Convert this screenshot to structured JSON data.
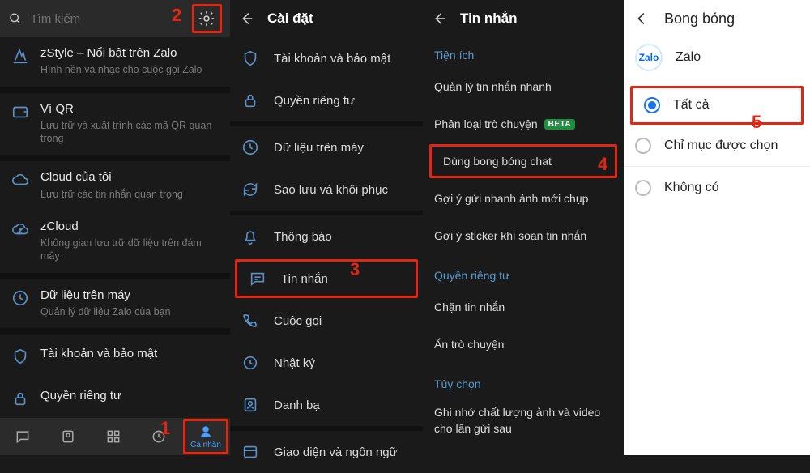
{
  "panel1": {
    "search_placeholder": "Tìm kiếm",
    "items": [
      {
        "title": "zStyle – Nổi bật trên Zalo",
        "sub": "Hình nền và nhạc cho cuộc gọi Zalo"
      },
      {
        "title": "Ví QR",
        "sub": "Lưu trữ và xuất trình các mã QR quan trọng"
      },
      {
        "title": "Cloud của tôi",
        "sub": "Lưu trữ các tin nhắn quan trọng"
      },
      {
        "title": "zCloud",
        "sub": "Không gian lưu trữ dữ liệu trên đám mây"
      },
      {
        "title": "Dữ liệu trên máy",
        "sub": "Quản lý dữ liệu Zalo của bạn"
      },
      {
        "title": "Tài khoản và bảo mật",
        "sub": ""
      },
      {
        "title": "Quyền riêng tư",
        "sub": ""
      }
    ],
    "nav_active_label": "Cá nhân"
  },
  "panel2": {
    "header": "Cài đặt",
    "rows": [
      "Tài khoản và bảo mật",
      "Quyền riêng tư",
      "Dữ liệu trên máy",
      "Sao lưu và khôi phục",
      "Thông báo",
      "Tin nhắn",
      "Cuộc gọi",
      "Nhật ký",
      "Danh bạ",
      "Giao diện và ngôn ngữ"
    ]
  },
  "panel3": {
    "header": "Tin nhắn",
    "section_utilities": "Tiện ích",
    "utilities": [
      "Quản lý tin nhắn nhanh",
      "Phân loại trò chuyện",
      "Dùng bong bóng chat",
      "Gợi ý gửi nhanh ảnh mới chụp",
      "Gợi ý sticker khi soạn tin nhắn"
    ],
    "beta": "BETA",
    "section_privacy": "Quyền riêng tư",
    "privacy": [
      "Chặn tin nhắn",
      "Ẩn trò chuyện"
    ],
    "section_opts": "Tùy chọn",
    "opts": [
      "Ghi nhớ chất lượng ảnh và video cho lần gửi sau"
    ]
  },
  "panel4": {
    "header": "Bong bóng",
    "app_name": "Zalo",
    "zalo_logo": "Zalo",
    "options": [
      {
        "label": "Tất cả",
        "checked": true
      },
      {
        "label": "Chỉ mục được chọn",
        "checked": false
      },
      {
        "label": "Không có",
        "checked": false
      }
    ]
  },
  "annotations": {
    "n1": "1",
    "n2": "2",
    "n3": "3",
    "n4": "4",
    "n5": "5"
  }
}
